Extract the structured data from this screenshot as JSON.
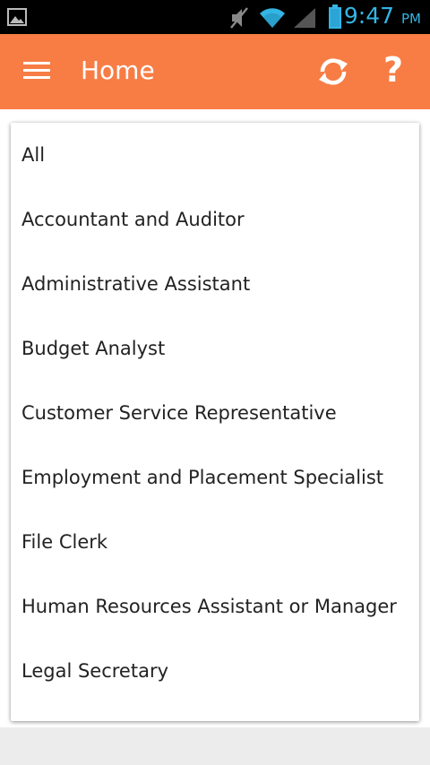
{
  "status_bar": {
    "time": "9:47",
    "ampm": "PM",
    "icons": [
      "image-icon",
      "mute-icon",
      "wifi-icon",
      "signal-icon",
      "battery-icon"
    ],
    "clock_color": "#33b5e5"
  },
  "app_bar": {
    "title": "Home",
    "background": "#f77d45",
    "help_label": "?",
    "icons": [
      "menu-icon",
      "refresh-icon",
      "help-icon"
    ]
  },
  "dropdown": {
    "items": [
      "All",
      "Accountant and Auditor",
      "Administrative Assistant",
      "Budget Analyst",
      "Customer Service Representative",
      "Employment and Placement Specialist",
      "File Clerk",
      "Human Resources Assistant or Manager",
      "Legal Secretary"
    ]
  }
}
